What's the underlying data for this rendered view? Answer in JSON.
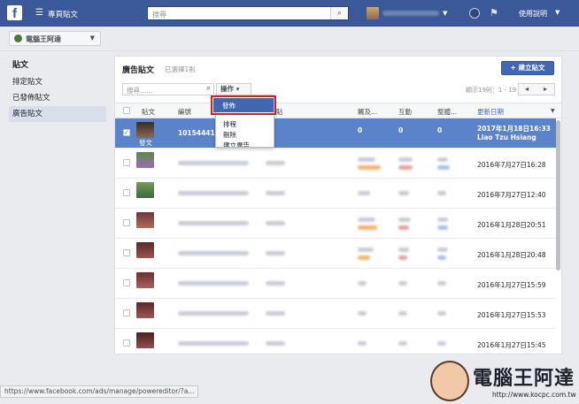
{
  "topbar": {
    "logo": "f",
    "title": "專頁貼文",
    "search_placeholder": "搜尋",
    "help": "使用說明"
  },
  "page_selector": {
    "label": "電腦王阿達"
  },
  "sidebar": {
    "heading": "貼文",
    "items": [
      {
        "label": "排定貼文"
      },
      {
        "label": "已發佈貼文"
      },
      {
        "label": "廣告貼文"
      }
    ]
  },
  "panel": {
    "title": "廣告貼文",
    "subtitle": "已選擇1則",
    "create_button": "+ 建立貼文",
    "search_placeholder": "搜尋......",
    "ops_button": "操作 ▾",
    "count": "顯示19則：1 - 19",
    "columns": [
      "貼文",
      "編號",
      "貼",
      "觸及...",
      "互動",
      "整體...",
      "更新日期"
    ],
    "rows": [
      {
        "post_label": "發文",
        "id": "1015444157",
        "reach": "0",
        "engagement": "0",
        "overall": "0",
        "date": "2017年1月18日16:33",
        "author": "Liao Tzu Hsiang"
      },
      {
        "date": "2016年7月27日16:28"
      },
      {
        "date": "2016年7月27日12:40"
      },
      {
        "date": "2016年1月28日20:51"
      },
      {
        "date": "2016年1月28日20:48"
      },
      {
        "date": "2016年1月27日15:59"
      },
      {
        "date": "2016年1月27日15:53"
      },
      {
        "date": "2016年1月27日15:45"
      }
    ]
  },
  "dropdown": {
    "items": [
      {
        "label": "發佈"
      },
      {
        "label": "排程"
      },
      {
        "label": "刪除"
      },
      {
        "label": "建立廣告"
      }
    ]
  },
  "status_url": "https://www.facebook.com/ads/manage/powereditor/?a...",
  "watermark": {
    "title": "電腦王阿達",
    "url": "http://www.kocpc.com.tw"
  },
  "colors": {
    "brand": "#3b5998",
    "selected_row": "#5b83c9",
    "highlight": "#c0282e"
  }
}
